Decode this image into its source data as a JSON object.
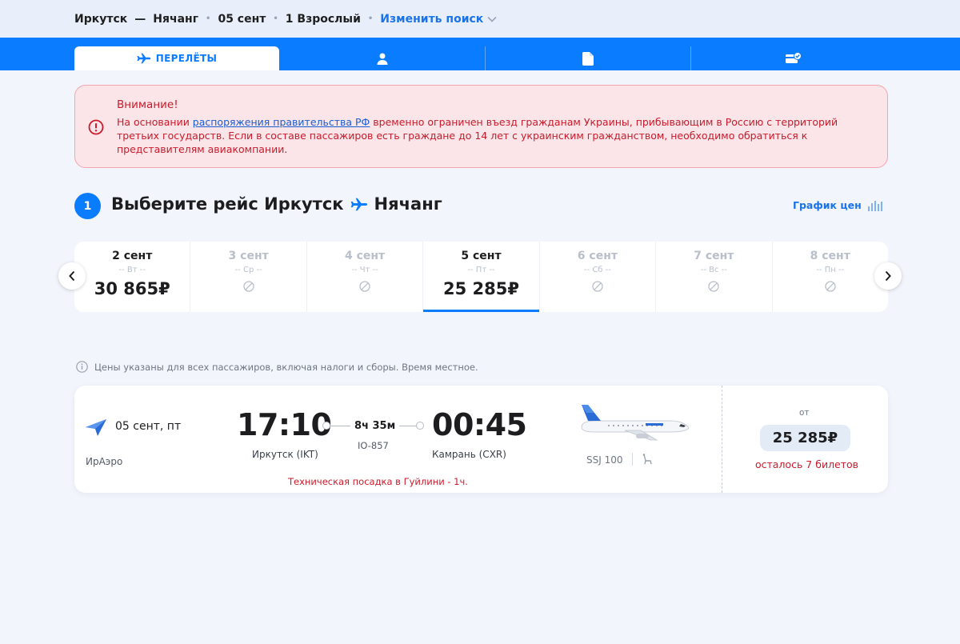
{
  "search": {
    "from": "Иркутск",
    "dash": "—",
    "to": "Нячанг",
    "date": "05 сент",
    "passengers": "1 Взрослый",
    "change": "Изменить поиск"
  },
  "tabs": {
    "flights_label": "ПЕРЕЛЁТЫ",
    "icons": [
      "plane-icon",
      "person-icon",
      "document-icon",
      "payment-icon"
    ]
  },
  "warning": {
    "title": "Внимание!",
    "text_before": "На основании ",
    "link": "распоряжения правительства РФ",
    "text_after": " временно ограничен въезд гражданам Украины, прибывающим в Россию с территорий третьих государств. Если в составе пассажиров есть граждане до 14 лет с украинским гражданством, необходимо обратиться к представителям авиакомпании."
  },
  "step": {
    "number": "1",
    "title_prefix": "Выберите рейс Иркутск",
    "title_dest": "Нячанг",
    "price_chart": "График цен"
  },
  "dates": [
    {
      "date": "2 сент",
      "weekday": "-- Вт --",
      "price": "30 865₽",
      "available": true,
      "selected": false
    },
    {
      "date": "3 сент",
      "weekday": "-- Ср --",
      "price": "",
      "available": false,
      "selected": false
    },
    {
      "date": "4 сент",
      "weekday": "-- Чт --",
      "price": "",
      "available": false,
      "selected": false
    },
    {
      "date": "5 сент",
      "weekday": "-- Пт --",
      "price": "25 285₽",
      "available": true,
      "selected": true
    },
    {
      "date": "6 сент",
      "weekday": "-- Сб --",
      "price": "",
      "available": false,
      "selected": false
    },
    {
      "date": "7 сент",
      "weekday": "-- Вс --",
      "price": "",
      "available": false,
      "selected": false
    },
    {
      "date": "8 сент",
      "weekday": "-- Пн --",
      "price": "",
      "available": false,
      "selected": false
    }
  ],
  "note": "Цены указаны для всех пассажиров, включая налоги и сборы. Время местное.",
  "flight": {
    "date": "05 сент, пт",
    "airline": "ИрАэро",
    "dep_time": "17:10",
    "dep_city": "Иркутск (IKT)",
    "duration": "8ч 35м",
    "flight_number": "IO-857",
    "arr_time": "00:45",
    "arr_city": "Камрань (CXR)",
    "stopover": "Техническая посадка в Гуйлини - 1ч.",
    "aircraft": "SSJ 100",
    "from_label": "от",
    "price": "25 285₽",
    "tickets_left": "осталось 7 билетов"
  },
  "colors": {
    "accent": "#0a7cff",
    "link": "#1a73e8",
    "warning_bg": "#fbe5e8",
    "warning_text": "#c91b2b",
    "page_bg": "#f2f5fb"
  }
}
